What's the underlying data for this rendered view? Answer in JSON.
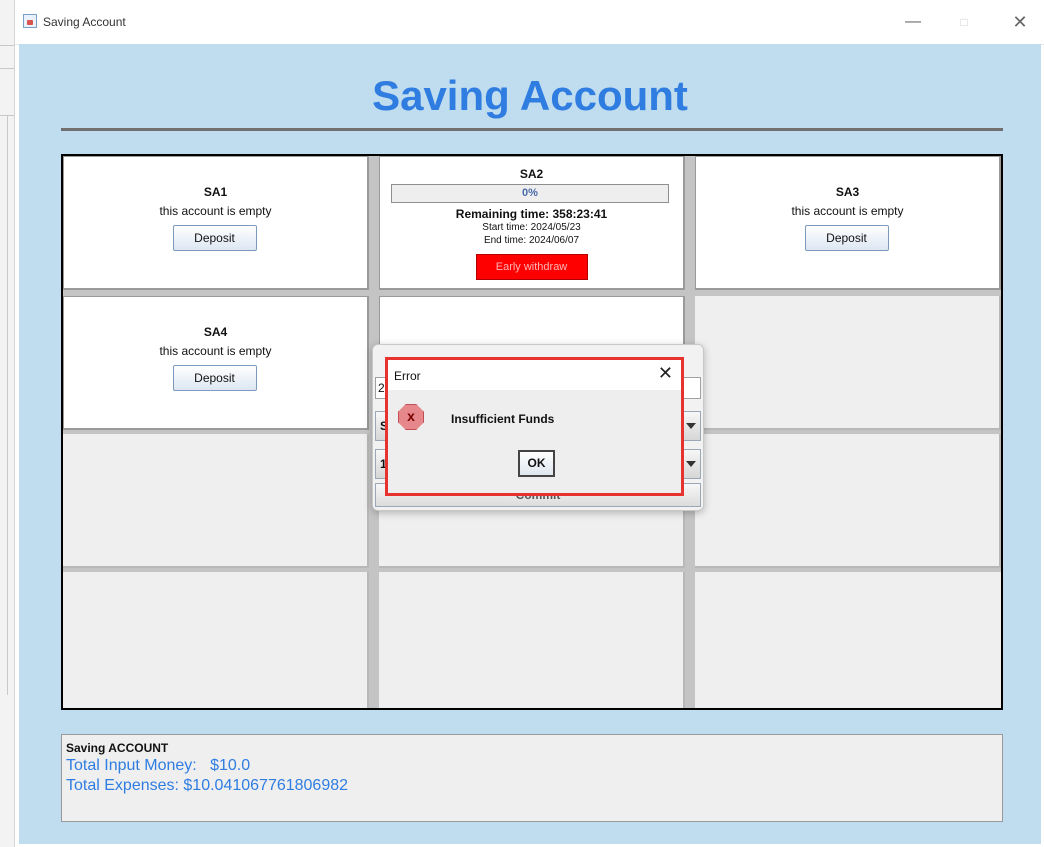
{
  "window": {
    "title": "Saving Account",
    "icon": "java-cup-icon",
    "controls": {
      "minimize": "—",
      "maximize": "□",
      "close": "✕"
    }
  },
  "heading": "Saving Account",
  "accounts": [
    {
      "name": "SA1",
      "status": "this account is empty",
      "button": "Deposit"
    },
    {
      "name": "SA2",
      "progress_label": "0%",
      "progress_value": 0,
      "remaining": "Remaining time: 358:23:41",
      "start": "Start time: 2024/05/23",
      "end": "End time: 2024/06/07",
      "button": "Early withdraw"
    },
    {
      "name": "SA3",
      "status": "this account is empty",
      "button": "Deposit"
    },
    {
      "name": "SA4",
      "status": "this account is empty",
      "button": "Deposit"
    }
  ],
  "background_form": {
    "field_value": "20",
    "combo1_value": "S",
    "combo2_value": "15",
    "commit_label": "Commit"
  },
  "error_dialog": {
    "title": "Error",
    "icon": "error-icon",
    "icon_glyph": "x",
    "close": "✕",
    "message": "Insufficient Funds",
    "ok_label": "OK"
  },
  "summary": {
    "title": "Saving ACCOUNT",
    "input_label": "Total Input Money:",
    "input_value": "$10.0",
    "expenses_label": "Total Expenses:",
    "expenses_value": "$10.041067761806982"
  },
  "colors": {
    "frame_bg": "#c0dcef",
    "heading": "#2f7de1",
    "early_withdraw": "#ff0000",
    "dialog_highlight": "#e8322e"
  }
}
